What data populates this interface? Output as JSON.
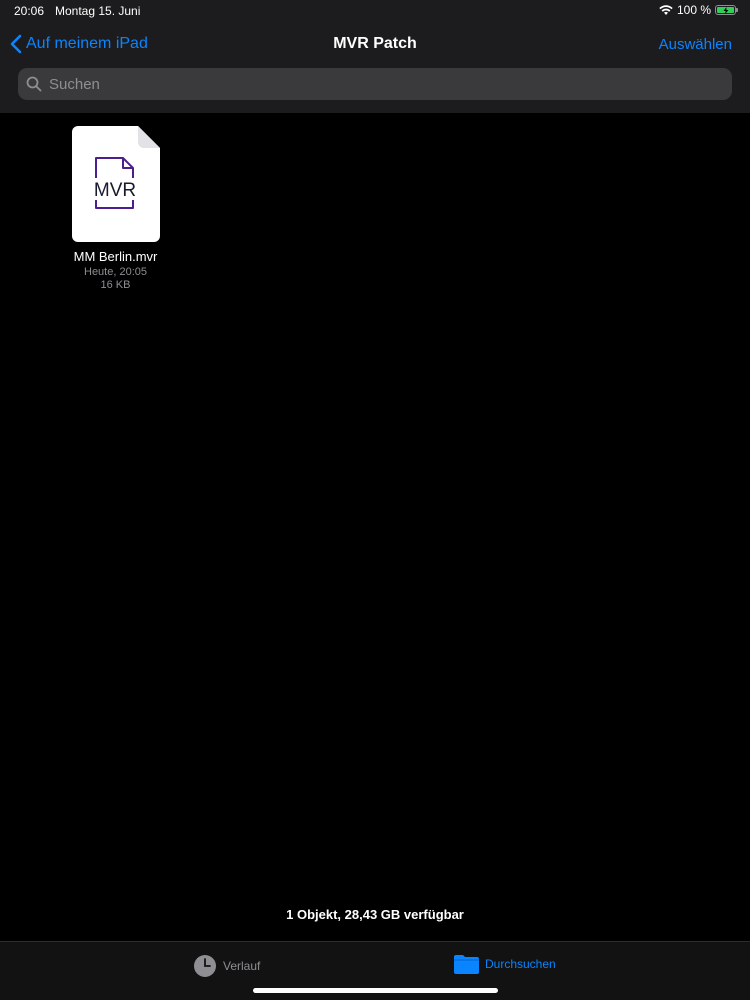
{
  "status_bar": {
    "time": "20:06",
    "date": "Montag 15. Juni",
    "battery": "100 %"
  },
  "nav": {
    "back_label": "Auf meinem iPad",
    "title": "MVR Patch",
    "select_label": "Auswählen"
  },
  "search": {
    "placeholder": "Suchen"
  },
  "files": [
    {
      "name": "MM Berlin.mvr",
      "thumb_label": "MVR",
      "date": "Heute, 20:05",
      "size": "16 KB"
    }
  ],
  "footer": {
    "summary": "1 Objekt, 28,43 GB verfügbar"
  },
  "tabs": [
    {
      "label": "Verlauf",
      "icon": "clock-icon",
      "active": false
    },
    {
      "label": "Durchsuchen",
      "icon": "folder-icon",
      "active": true
    }
  ],
  "colors": {
    "accent": "#0a84ff",
    "background": "#000000",
    "header": "#1c1c1e",
    "battery": "#30d158",
    "mvr_icon": "#4b1f8f"
  }
}
